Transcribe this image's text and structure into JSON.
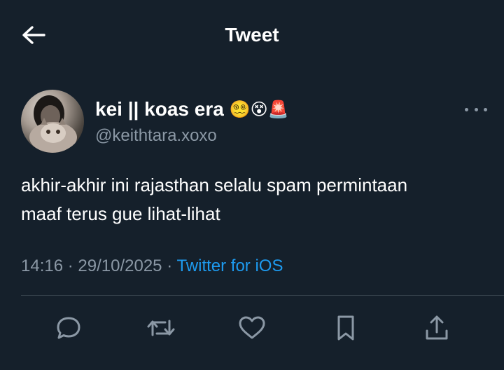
{
  "header": {
    "title": "Tweet"
  },
  "tweet": {
    "author": {
      "display_name": "kei || koas era",
      "name_emojis": "😵‍💫😵🚨",
      "handle": "@keithtara.xoxo"
    },
    "text_line1": "akhir-akhir ini rajasthan selalu spam permintaan",
    "text_line2": "maaf terus gue lihat-lihat",
    "time": "14:16",
    "date": "29/10/2025",
    "separator": "·",
    "source": "Twitter for iOS"
  },
  "actions": [
    "reply-icon",
    "retweet-icon",
    "like-icon",
    "bookmark-icon",
    "share-icon"
  ],
  "colors": {
    "background": "#15202b",
    "text": "#ffffff",
    "muted": "#8b98a5",
    "accent": "#1d9bf0",
    "divider": "#38444d"
  }
}
